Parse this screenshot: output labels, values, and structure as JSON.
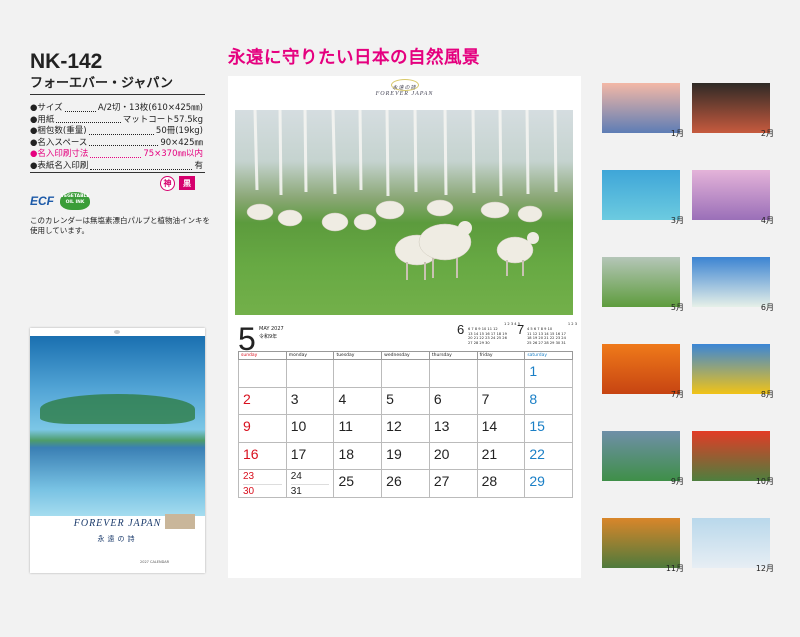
{
  "product": {
    "code": "NK-142",
    "name": "フォーエバー・ジャパン"
  },
  "specs": [
    {
      "label": "●サイズ",
      "value": "A/2切・13枚(610×425㎜)",
      "pink": false
    },
    {
      "label": "●用紙",
      "value": "マットコート57.5kg",
      "pink": false
    },
    {
      "label": "●梱包数(重量)",
      "value": "50冊(19kg)",
      "pink": false
    },
    {
      "label": "●名入スペース",
      "value": "90×425㎜",
      "pink": false
    },
    {
      "label": "●名入印刷寸法",
      "value": "75×370㎜以内",
      "pink": true
    },
    {
      "label": "●表紙名入印刷",
      "value": "有",
      "pink": false
    }
  ],
  "badges": [
    "神",
    "黒"
  ],
  "eco": {
    "ecf": "ECF",
    "veg": "VEGETABLE OIL INK",
    "note": "このカレンダーは無塩素漂白パルプと植物油インキを使用しています。"
  },
  "cover": {
    "title": "FOREVER JAPAN",
    "subtitle": "永遠の詩",
    "footer": "2027 CALENDAR"
  },
  "headline": "永遠に守りたい日本の自然風景",
  "sheet": {
    "logo_jp": "永遠の詩",
    "logo_en": "FOREVER JAPAN",
    "month": "5",
    "month_en": "MAY 2027",
    "era": "令和9年",
    "mini6": {
      "label": "6",
      "rows": [
        "",
        "1 2 3 4 5",
        "6 7 8 9 10 11 12",
        "13 14 15 16 17 18 19",
        "20 21 22 23 24 25 26",
        "27 28 29 30"
      ]
    },
    "mini7": {
      "label": "7",
      "rows": [
        "",
        "1 2 3",
        "4 5 6 7 8 9 10",
        "11 12 13 14 15 16 17",
        "18 19 20 21 22 23 24",
        "25 26 27 28 29 30 31"
      ]
    },
    "weekdays": [
      "sunday",
      "monday",
      "tuesday",
      "wednesday",
      "thursday",
      "friday",
      "saturday"
    ],
    "weeks": [
      [
        "",
        "",
        "",
        "",
        "",
        "",
        "1"
      ],
      [
        "2",
        "3",
        "4",
        "5",
        "6",
        "7",
        "8"
      ],
      [
        "9",
        "10",
        "11",
        "12",
        "13",
        "14",
        "15"
      ],
      [
        "16",
        "17",
        "18",
        "19",
        "20",
        "21",
        "22"
      ],
      [
        "23/30",
        "24/31",
        "25",
        "26",
        "27",
        "28",
        "29"
      ]
    ]
  },
  "thumbnails": [
    {
      "label": "1月",
      "c1": "#f3b8a6",
      "c2": "#5d7db5"
    },
    {
      "label": "2月",
      "c1": "#2f2a26",
      "c2": "#c75a3e"
    },
    {
      "label": "3月",
      "c1": "#3fa6d8",
      "c2": "#6ccbe0"
    },
    {
      "label": "4月",
      "c1": "#e4b3d9",
      "c2": "#9a6fb8"
    },
    {
      "label": "5月",
      "c1": "#b5c6b8",
      "c2": "#5e9c3d"
    },
    {
      "label": "6月",
      "c1": "#3c84d2",
      "c2": "#e6f0e8"
    },
    {
      "label": "7月",
      "c1": "#ef7a1a",
      "c2": "#c74412"
    },
    {
      "label": "8月",
      "c1": "#3b86d6",
      "c2": "#f1c317"
    },
    {
      "label": "9月",
      "c1": "#6f8fa8",
      "c2": "#3f8f48"
    },
    {
      "label": "10月",
      "c1": "#e23b26",
      "c2": "#4d7f3e"
    },
    {
      "label": "11月",
      "c1": "#d9862a",
      "c2": "#4e7a3c"
    },
    {
      "label": "12月",
      "c1": "#b9d8eb",
      "c2": "#e7eef4"
    }
  ]
}
